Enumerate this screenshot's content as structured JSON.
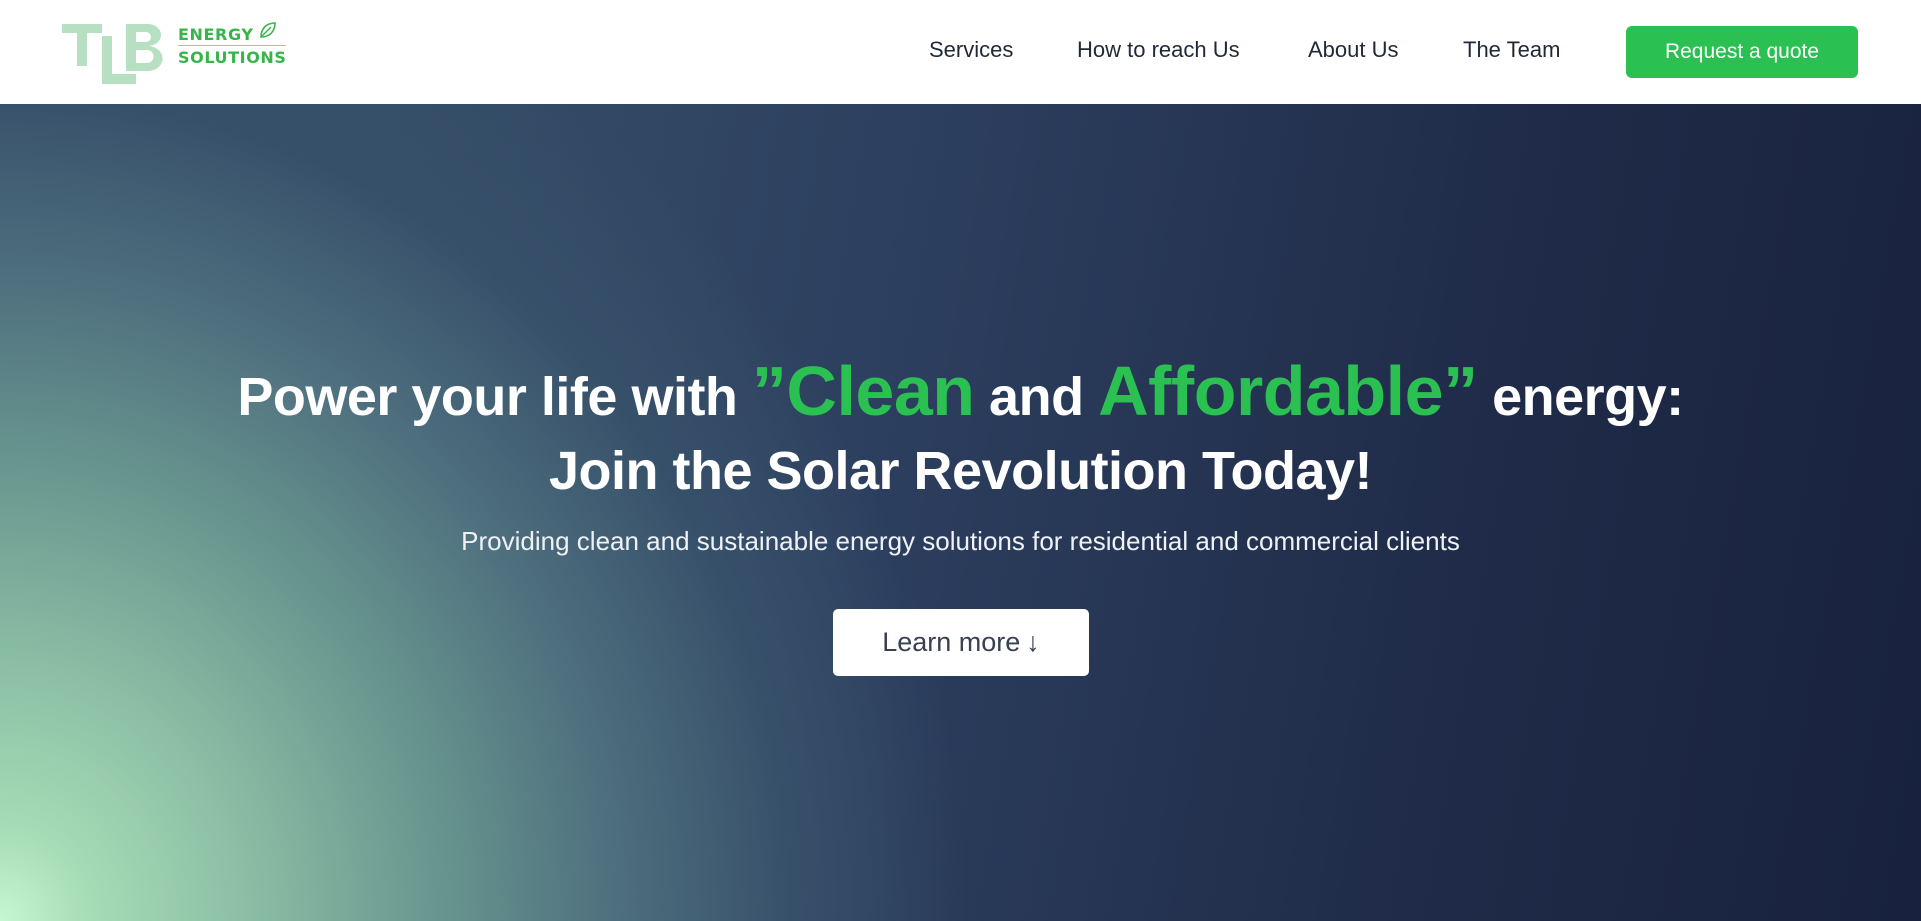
{
  "brand": {
    "mark": "TLB",
    "line1": "ENERGY",
    "line2": "SOLUTIONS"
  },
  "nav": {
    "links": [
      {
        "label": "Services"
      },
      {
        "label": "How to reach Us"
      },
      {
        "label": "About Us"
      },
      {
        "label": "The Team"
      }
    ],
    "cta_label": "Request a quote"
  },
  "hero": {
    "headline_part1": "Power your life with ",
    "headline_green1": "”Clean",
    "headline_part2": " and ",
    "headline_green2": "Affordable”",
    "headline_part3": " energy:",
    "headline_line2": "Join the Solar Revolution Today!",
    "subtitle": "Providing clean and sustainable energy solutions for residential and commercial clients",
    "button_label": "Learn more",
    "button_icon": "arrow-down-icon"
  },
  "colors": {
    "accent": "#2bc052",
    "hero_dark": "#18223e",
    "hero_glow": "#c6f7d2"
  }
}
